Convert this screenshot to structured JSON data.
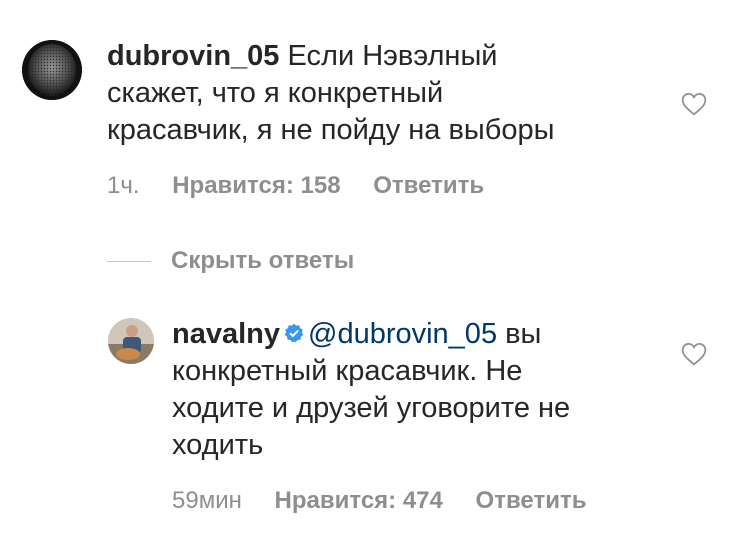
{
  "comments": [
    {
      "username": "dubrovin_05",
      "text": "Если Нэвэлный скажет, что я конкретный красавчик, я не пойду на выборы",
      "line1_rest": "Если Нэвэлный",
      "line2": "скажет, что я конкретный",
      "line3": "красавчик, я не пойду на выборы",
      "time": "1ч.",
      "likes": "Нравится: 158",
      "reply": "Ответить"
    },
    {
      "username": "navalny",
      "mention": "@dubrovin_05",
      "line1_rest": "вы",
      "line2": "конкретный красавчик. Не",
      "line3": "ходите и друзей уговорите не",
      "line4": "ходить",
      "time": "59мин",
      "likes": "Нравится: 474",
      "reply": "Ответить"
    }
  ],
  "replies_toggle": "Скрыть ответы",
  "icons": {
    "like": "heart-outline-icon",
    "verified": "verified-badge-icon"
  },
  "colors": {
    "text": "#262626",
    "secondary": "#8e8e8e",
    "mention": "#00376b",
    "verified": "#3897f0"
  }
}
